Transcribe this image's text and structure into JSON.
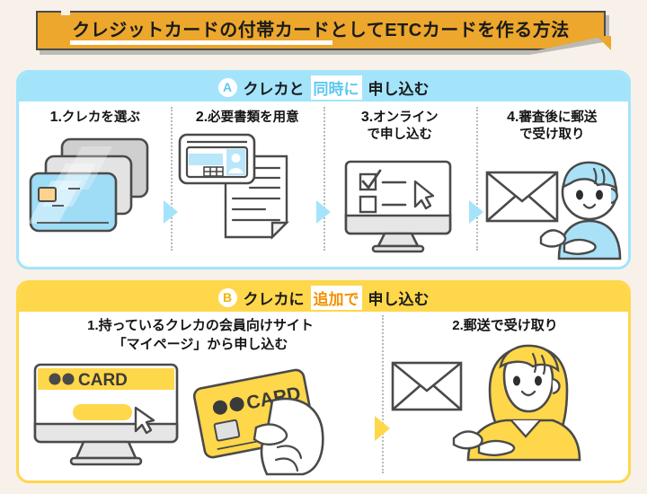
{
  "title": {
    "text": "クレジットカードの付帯カードとしてETCカードを作る方法"
  },
  "sections": [
    {
      "badge": "A",
      "head_pre": "クレカと",
      "head_highlight": "同時に",
      "head_post": "申し込む",
      "steps": [
        {
          "num": "1.",
          "label": "クレカを選ぶ",
          "art": "stacked-credit-cards"
        },
        {
          "num": "2.",
          "label": "必要書類を用意",
          "art": "id-card-and-document"
        },
        {
          "num": "3.",
          "label": "オンライン\nで申し込む",
          "art": "monitor-checklist-cursor"
        },
        {
          "num": "4.",
          "label": "審査後に郵送\nで受け取り",
          "art": "person-receiving-envelope"
        }
      ]
    },
    {
      "badge": "B",
      "head_pre": "クレカに",
      "head_highlight": "追加で",
      "head_post": "申し込む",
      "steps": [
        {
          "num": "1.",
          "label": "持っているクレカの会員向けサイト\n「マイページ」から申し込む",
          "art": "monitor-card-site-and-hand-holding-card"
        },
        {
          "num": "2.",
          "label": "郵送で受け取り",
          "art": "woman-receiving-envelope"
        }
      ]
    }
  ],
  "art_text": {
    "card_site_label": "CARD",
    "hand_card_label": "CARD"
  },
  "colors": {
    "background": "#f7f1ea",
    "title_band": "#eca72c",
    "blue": "#a3e4fb",
    "yellow": "#ffd74a",
    "card_blue": "#9fdcf5",
    "ink": "#4a4a4a"
  }
}
